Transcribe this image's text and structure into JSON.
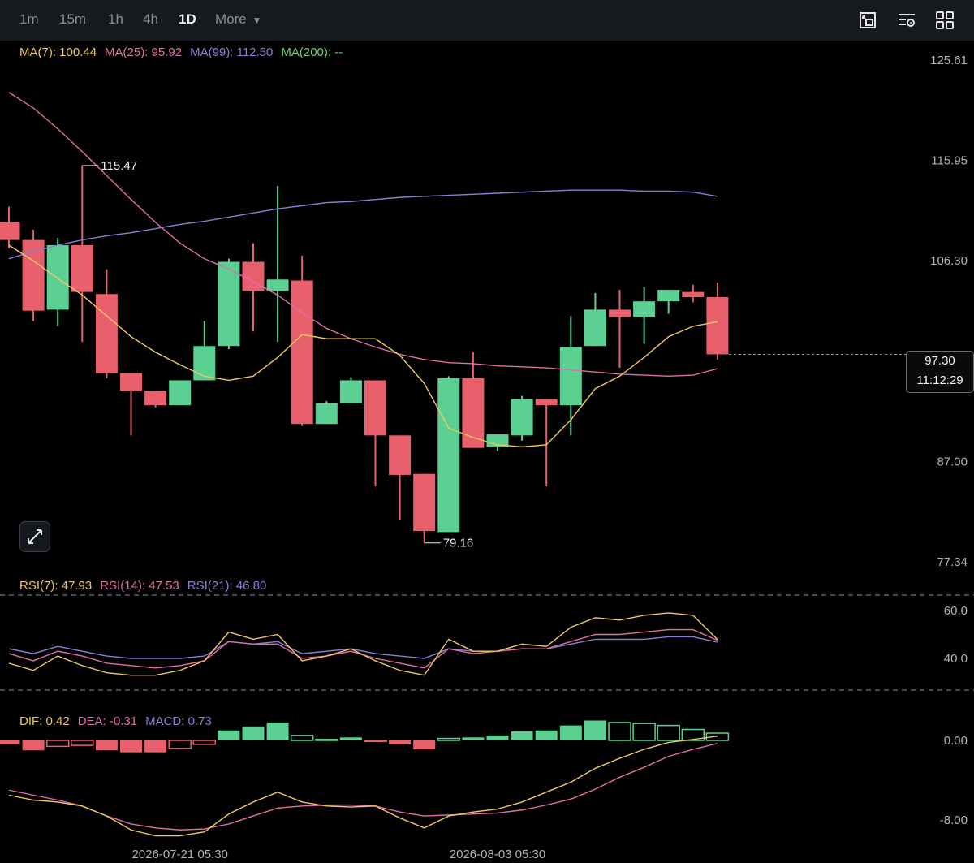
{
  "toolbar": {
    "timeframes": [
      "1m",
      "15m",
      "1h",
      "4h",
      "1D"
    ],
    "active": "1D",
    "more_label": "More",
    "icons": [
      "chart-screenshot-icon",
      "indicator-settings-icon",
      "layout-grid-icon"
    ]
  },
  "legend": {
    "ma": [
      {
        "label": "MA(7)",
        "value": "100.44",
        "color": "#f0c861"
      },
      {
        "label": "MA(25)",
        "value": "95.92",
        "color": "#e06ea8"
      },
      {
        "label": "MA(99)",
        "value": "112.50",
        "color": "#8b7fd6"
      },
      {
        "label": "MA(200)",
        "value": "--",
        "color": "#6fce6f"
      }
    ],
    "rsi": [
      {
        "label": "RSI(7)",
        "value": "47.93",
        "color": "#f0c861"
      },
      {
        "label": "RSI(14)",
        "value": "47.53",
        "color": "#e06ea8"
      },
      {
        "label": "RSI(21)",
        "value": "46.80",
        "color": "#8b7fd6"
      }
    ],
    "macd": [
      {
        "label": "DIF",
        "value": "0.42",
        "color": "#f0c861"
      },
      {
        "label": "DEA",
        "value": "-0.31",
        "color": "#e06ea8"
      },
      {
        "label": "MACD",
        "value": "0.73",
        "color": "#8b7fd6"
      }
    ]
  },
  "colors": {
    "up": "#5ccf92",
    "down": "#e8606c",
    "axis_text": "#b0b4ba",
    "dashed": "#8a8f98"
  },
  "last_price": {
    "price": "97.30",
    "countdown": "11:12:29"
  },
  "chart_data": {
    "type": "candlestick",
    "price_axis_ticks": [
      "125.61",
      "115.95",
      "106.30",
      "97.30",
      "87.00",
      "77.34"
    ],
    "rsi_axis_ticks": [
      "60.0",
      "40.0"
    ],
    "macd_axis_ticks": [
      "0.00",
      "-8.00"
    ],
    "x_labels": [
      {
        "index": 7,
        "label": "2026-07-21 05:30"
      },
      {
        "index": 20,
        "label": "2026-08-03 05:30"
      }
    ],
    "annotations": [
      {
        "label": "115.47",
        "index": 3,
        "price": 115.47
      },
      {
        "label": "79.16",
        "index": 17,
        "price": 79.16
      }
    ],
    "candles": [
      {
        "o": 110.0,
        "h": 111.5,
        "l": 107.5,
        "c": 108.3
      },
      {
        "o": 108.3,
        "h": 109.3,
        "l": 100.5,
        "c": 101.5
      },
      {
        "o": 101.6,
        "h": 108.5,
        "l": 100.0,
        "c": 107.8
      },
      {
        "o": 107.8,
        "h": 115.47,
        "l": 98.5,
        "c": 103.3
      },
      {
        "o": 103.1,
        "h": 105.5,
        "l": 95.0,
        "c": 95.5
      },
      {
        "o": 95.5,
        "h": 95.5,
        "l": 89.5,
        "c": 93.8
      },
      {
        "o": 93.8,
        "h": 93.8,
        "l": 92.2,
        "c": 92.4
      },
      {
        "o": 92.4,
        "h": 94.8,
        "l": 92.4,
        "c": 94.8
      },
      {
        "o": 94.8,
        "h": 100.5,
        "l": 94.8,
        "c": 98.1
      },
      {
        "o": 98.1,
        "h": 106.5,
        "l": 97.8,
        "c": 106.2
      },
      {
        "o": 106.2,
        "h": 108.0,
        "l": 99.5,
        "c": 103.4
      },
      {
        "o": 103.4,
        "h": 113.5,
        "l": 98.5,
        "c": 104.5
      },
      {
        "o": 104.4,
        "h": 106.8,
        "l": 90.4,
        "c": 90.6
      },
      {
        "o": 90.6,
        "h": 92.8,
        "l": 90.6,
        "c": 92.6
      },
      {
        "o": 92.6,
        "h": 95.1,
        "l": 92.6,
        "c": 94.8
      },
      {
        "o": 94.8,
        "h": 94.8,
        "l": 84.6,
        "c": 89.5
      },
      {
        "o": 89.5,
        "h": 89.5,
        "l": 81.4,
        "c": 85.7
      },
      {
        "o": 85.8,
        "h": 85.8,
        "l": 79.16,
        "c": 80.3
      },
      {
        "o": 80.2,
        "h": 95.2,
        "l": 80.2,
        "c": 95.0
      },
      {
        "o": 95.0,
        "h": 97.5,
        "l": 89.0,
        "c": 88.3
      },
      {
        "o": 88.4,
        "h": 89.5,
        "l": 88.0,
        "c": 89.6
      },
      {
        "o": 89.5,
        "h": 93.3,
        "l": 89.0,
        "c": 93.0
      },
      {
        "o": 93.0,
        "h": 93.0,
        "l": 84.6,
        "c": 92.4
      },
      {
        "o": 92.4,
        "h": 101.0,
        "l": 89.5,
        "c": 98.0
      },
      {
        "o": 98.1,
        "h": 103.2,
        "l": 98.1,
        "c": 101.6
      },
      {
        "o": 101.6,
        "h": 103.5,
        "l": 96.0,
        "c": 100.9
      },
      {
        "o": 100.9,
        "h": 103.8,
        "l": 98.3,
        "c": 102.4
      },
      {
        "o": 102.4,
        "h": 103.5,
        "l": 101.2,
        "c": 103.5
      },
      {
        "o": 103.3,
        "h": 104.0,
        "l": 102.3,
        "c": 102.8
      },
      {
        "o": 102.8,
        "h": 104.2,
        "l": 96.8,
        "c": 97.3
      }
    ],
    "ma7": [
      107.8,
      106.3,
      104.6,
      103.0,
      101.0,
      99.0,
      97.5,
      96.3,
      95.2,
      94.8,
      95.2,
      97.0,
      99.2,
      98.8,
      98.8,
      98.8,
      97.2,
      94.5,
      90.2,
      89.3,
      88.6,
      88.4,
      88.6,
      91.0,
      94.0,
      95.2,
      97.0,
      99.0,
      100.0,
      100.44
    ],
    "ma25": [
      122.5,
      121.0,
      119.0,
      116.8,
      114.5,
      112.2,
      110.0,
      108.0,
      106.5,
      105.5,
      104.3,
      103.0,
      101.3,
      99.8,
      98.8,
      98.0,
      97.3,
      96.8,
      96.5,
      96.4,
      96.2,
      96.1,
      96.0,
      95.8,
      95.6,
      95.4,
      95.3,
      95.2,
      95.3,
      95.92
    ],
    "ma99": [
      106.5,
      107.2,
      107.8,
      108.3,
      108.7,
      109.0,
      109.4,
      109.8,
      110.1,
      110.5,
      110.9,
      111.3,
      111.6,
      111.9,
      112.0,
      112.2,
      112.4,
      112.5,
      112.6,
      112.7,
      112.8,
      112.9,
      113.0,
      113.1,
      113.1,
      113.1,
      113.0,
      113.0,
      112.9,
      112.5
    ],
    "rsi7": [
      38,
      35,
      41,
      37,
      34,
      33,
      33,
      35,
      39,
      51,
      48,
      50,
      39,
      41,
      44,
      39,
      35,
      33,
      48,
      43,
      43,
      46,
      45,
      53,
      57,
      56,
      58,
      59,
      58,
      47.93
    ],
    "rsi14": [
      42,
      39,
      43,
      41,
      38,
      37,
      36,
      37,
      39,
      47,
      46,
      46,
      40,
      41,
      43,
      40,
      38,
      36,
      44,
      42,
      43,
      44,
      44,
      47,
      50,
      50,
      51,
      52,
      52,
      47.53
    ],
    "rsi21": [
      44,
      42,
      45,
      43,
      41,
      40,
      40,
      40,
      41,
      47,
      46,
      47,
      42,
      43,
      44,
      42,
      41,
      40,
      44,
      43,
      43,
      44,
      44,
      46,
      48,
      48,
      48,
      49,
      49,
      46.8
    ],
    "macd_hist": [
      -0.4,
      -1.0,
      -0.6,
      -0.5,
      -1.0,
      -1.2,
      -1.2,
      -0.8,
      -0.4,
      1.0,
      1.4,
      1.8,
      0.5,
      0.1,
      0.3,
      -0.1,
      -0.4,
      -0.9,
      0.2,
      0.3,
      0.5,
      0.9,
      1.0,
      1.5,
      2.0,
      1.8,
      1.7,
      1.5,
      1.1,
      0.73
    ],
    "dif": [
      -5.5,
      -6.0,
      -6.2,
      -6.6,
      -7.6,
      -9.0,
      -9.6,
      -9.6,
      -9.2,
      -7.4,
      -6.2,
      -5.2,
      -6.2,
      -6.6,
      -6.7,
      -6.6,
      -7.8,
      -8.8,
      -7.6,
      -7.2,
      -6.9,
      -6.2,
      -5.2,
      -4.2,
      -2.8,
      -1.8,
      -0.9,
      -0.2,
      0.1,
      0.42
    ],
    "dea": [
      -5.0,
      -5.5,
      -6.0,
      -6.6,
      -7.6,
      -8.4,
      -8.8,
      -9.0,
      -8.9,
      -8.4,
      -7.6,
      -6.8,
      -6.6,
      -6.5,
      -6.5,
      -6.6,
      -7.2,
      -7.6,
      -7.5,
      -7.4,
      -7.3,
      -7.0,
      -6.5,
      -5.9,
      -4.9,
      -3.7,
      -2.7,
      -1.6,
      -0.9,
      -0.31
    ]
  }
}
